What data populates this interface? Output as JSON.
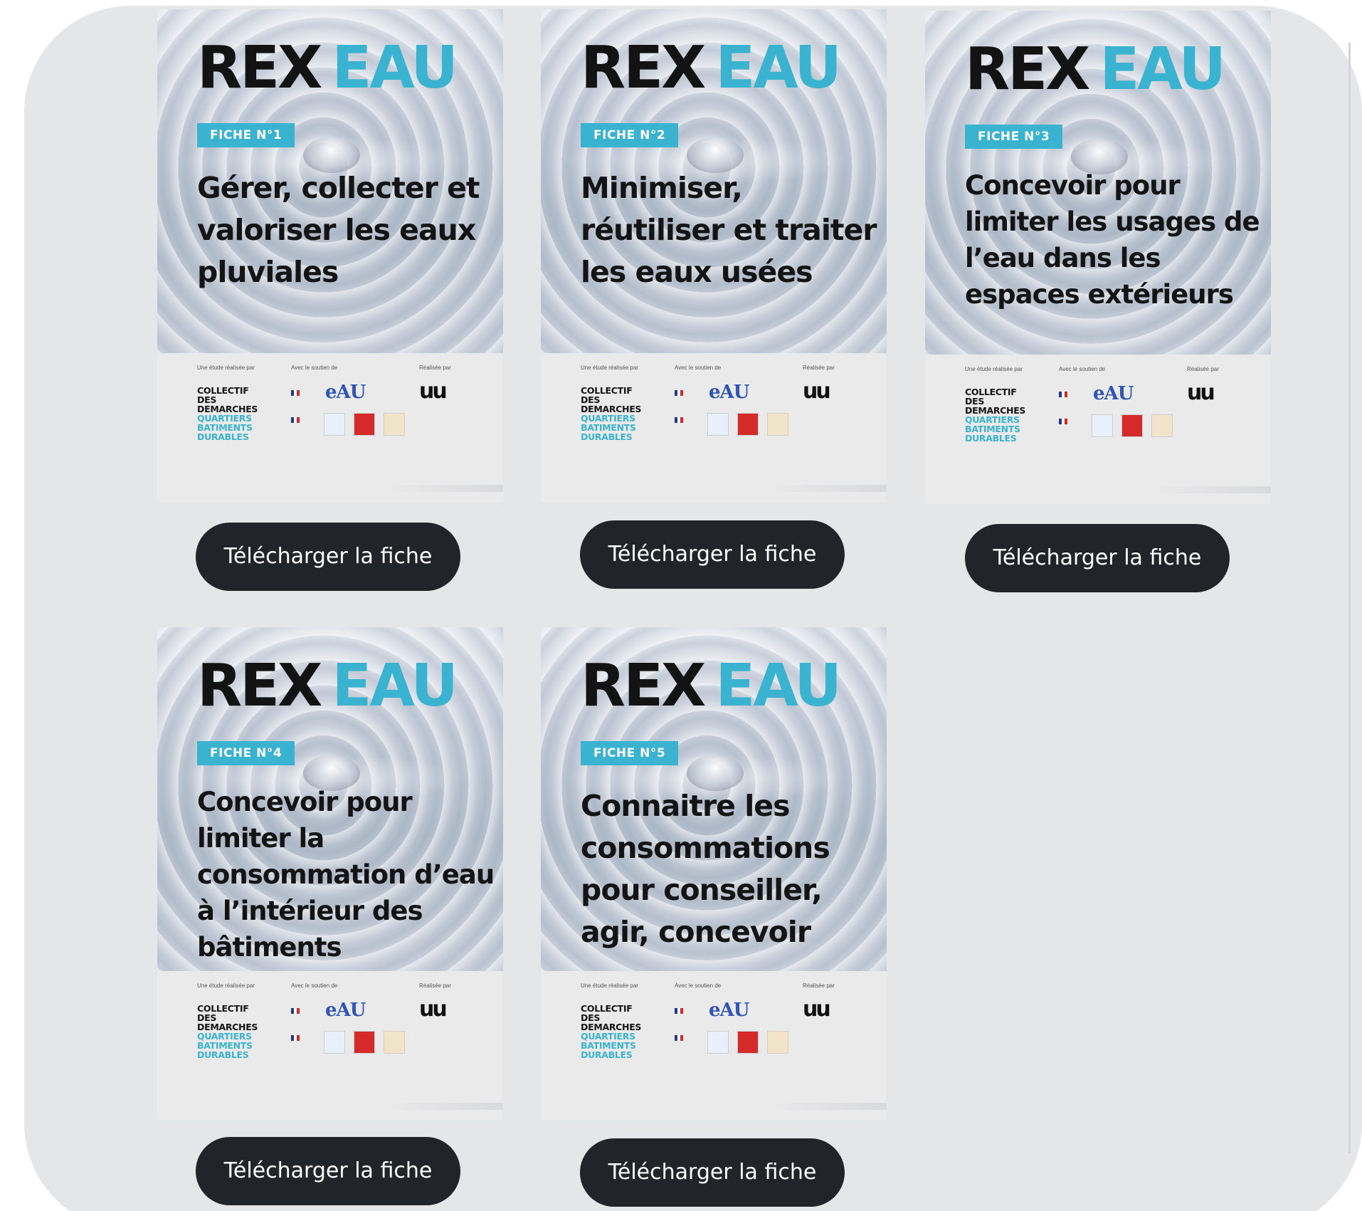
{
  "cards": [
    {
      "logo": {
        "rex": "REX",
        "eau": "EAU"
      },
      "badge": "FICHE N°1",
      "title": "Gérer, collecter et valoriser les eaux pluviales",
      "button": "Télécharger la fiche"
    },
    {
      "logo": {
        "rex": "REX",
        "eau": "EAU"
      },
      "badge": "FICHE N°2",
      "title": "Minimiser, réutiliser et traiter les eaux usées",
      "button": "Télécharger la fiche"
    },
    {
      "logo": {
        "rex": "REX",
        "eau": "EAU"
      },
      "badge": "FICHE N°3",
      "title": "Concevoir pour limiter les usages de l’eau dans les espaces extérieurs",
      "button": "Télécharger la fiche"
    },
    {
      "logo": {
        "rex": "REX",
        "eau": "EAU"
      },
      "badge": "FICHE N°4",
      "title": "Concevoir pour limiter la consommation d’eau à l’intérieur des bâtiments",
      "button": "Télécharger la fiche"
    },
    {
      "logo": {
        "rex": "REX",
        "eau": "EAU"
      },
      "badge": "FICHE N°5",
      "title": "Connaitre les consommations pour conseiller, agir, concevoir",
      "button": "Télécharger la fiche"
    }
  ],
  "footer": {
    "study_caption": "Une étude réalisée par",
    "support_caption": "Avec le soutien de",
    "by_caption": "Réalisée par",
    "collectif_dark": [
      "COLLECTIF",
      "DES",
      "DEMARCHES"
    ],
    "collectif_blue": [
      "QUARTIERS",
      "BATIMENTS",
      "DURABLES"
    ],
    "eau_logo": "eAU",
    "uu_logo": "uu"
  },
  "colors": {
    "accent": "#3ab3d0",
    "button_bg": "#212429",
    "panel_bg": "#e5e6e8"
  }
}
